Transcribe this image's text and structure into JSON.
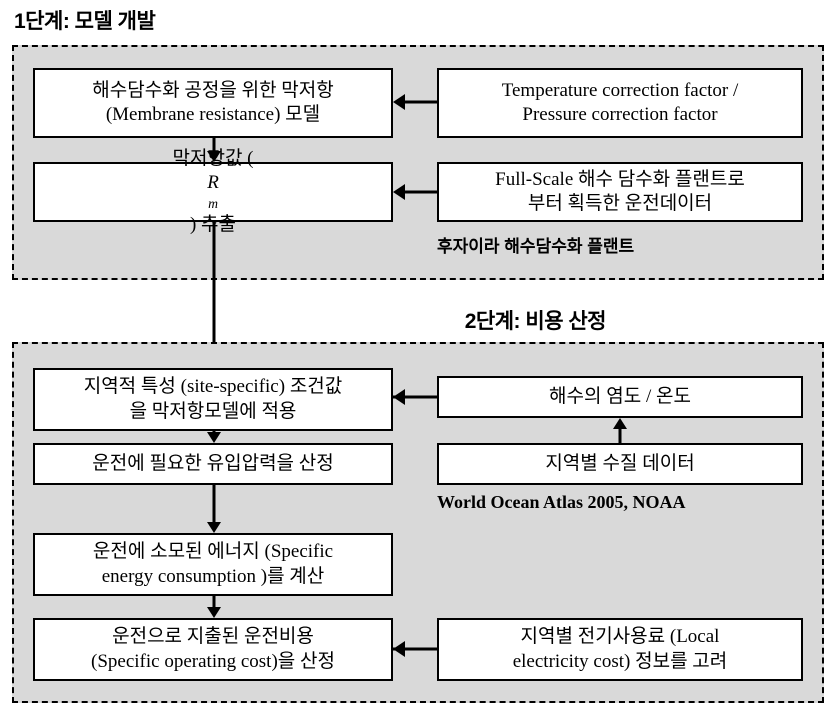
{
  "diagram": {
    "type": "flowchart",
    "title_stage1": "1단계: 모델 개발",
    "title_stage2": "2단계: 비용 산정",
    "colors": {
      "stage_fill": "#d9d9d9",
      "node_fill": "#ffffff",
      "stroke": "#000000"
    }
  },
  "stage1": {
    "title": "1단계: 모델 개발",
    "nodes": {
      "membrane_model": {
        "line1": "해수담수화 공정을 위한 막저항",
        "line2": "(Membrane resistance) 모델"
      },
      "rm_extract": {
        "prefix": "막저항값 (",
        "variable": "R",
        "subscript": "m",
        "suffix": ") 추출"
      },
      "correction_factor": {
        "line1": "Temperature correction factor /",
        "line2": "Pressure correction factor"
      },
      "fullscale_data": {
        "line1": "Full-Scale 해수 담수화 플랜트로",
        "line2": "부터 획득한 운전데이터"
      }
    },
    "caption": "후자이라 해수담수화 플랜트"
  },
  "stage2": {
    "title": "2단계: 비용 산정",
    "nodes": {
      "site_specific": {
        "line1": "지역적 특성 (site-specific) 조건값",
        "line2": "을 막저항모델에 적용"
      },
      "feed_pressure": {
        "line1": "운전에 필요한 유입압력을 산정"
      },
      "specific_energy": {
        "line1": "운전에 소모된 에너지 (Specific",
        "line2": "energy consumption )를 계산"
      },
      "operating_cost": {
        "line1": "운전으로 지출된 운전비용",
        "line2": "(Specific operating cost)을 산정"
      },
      "salinity_temperature": {
        "line1": "해수의 염도 / 온도"
      },
      "water_quality": {
        "line1": "지역별 수질 데이터"
      },
      "electricity_cost": {
        "line1": "지역별 전기사용료 (Local",
        "line2": "electricity cost) 정보를 고려"
      }
    },
    "caption": "World Ocean Atlas 2005, NOAA"
  }
}
